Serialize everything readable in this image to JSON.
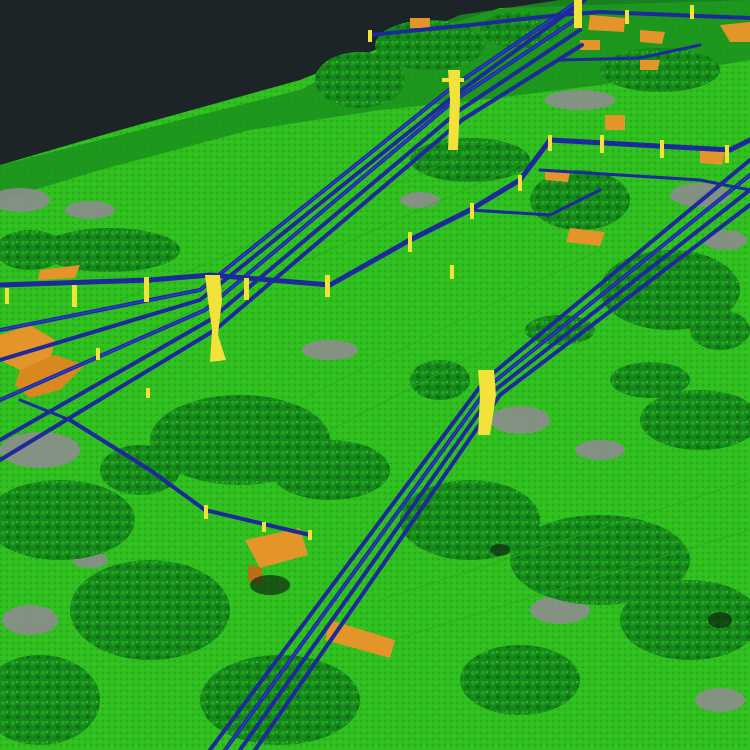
{
  "scene": {
    "kind": "3D LiDAR point-cloud classification view",
    "classes": {
      "sky_background": "#1d2428",
      "ground": "#2fbf1f",
      "ground_dark": "#1f8f17",
      "vegetation": "#16871a",
      "vegetation_highlight": "#3ccc2a",
      "unclassified": "#8a8a8a",
      "building": "#e3952a",
      "building_dark": "#b86f15",
      "power_line": "#1c2a9a",
      "power_line_highlight": "#2f46d8",
      "pylon": "#f2e23a"
    }
  }
}
